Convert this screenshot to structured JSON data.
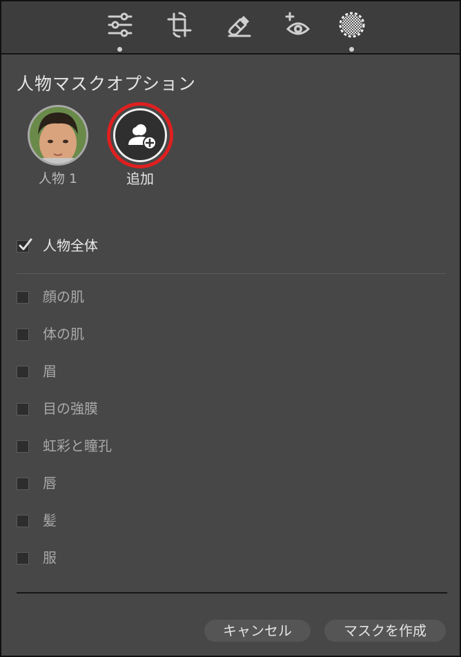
{
  "toolbar": {
    "tools": [
      {
        "icon": "sliders-icon",
        "active": true
      },
      {
        "icon": "crop-rotate-icon",
        "active": false
      },
      {
        "icon": "eraser-icon",
        "active": false
      },
      {
        "icon": "red-eye-icon",
        "active": false
      },
      {
        "icon": "mask-icon",
        "active": true
      }
    ]
  },
  "panel": {
    "title": "人物マスクオプション",
    "people": [
      {
        "label": "人物 1",
        "icon": "person-face-avatar"
      }
    ],
    "add": {
      "label": "追加",
      "icon": "add-person-icon",
      "highlight_color": "#e01f1f"
    }
  },
  "options": {
    "entire_person": {
      "label": "人物全体",
      "checked": true
    },
    "parts": [
      {
        "label": "顔の肌",
        "checked": false
      },
      {
        "label": "体の肌",
        "checked": false
      },
      {
        "label": "眉",
        "checked": false
      },
      {
        "label": "目の強膜",
        "checked": false
      },
      {
        "label": "虹彩と瞳孔",
        "checked": false
      },
      {
        "label": "唇",
        "checked": false
      },
      {
        "label": "髪",
        "checked": false
      },
      {
        "label": "服",
        "checked": false
      }
    ]
  },
  "footer": {
    "cancel_label": "キャンセル",
    "create_label": "マスクを作成"
  }
}
